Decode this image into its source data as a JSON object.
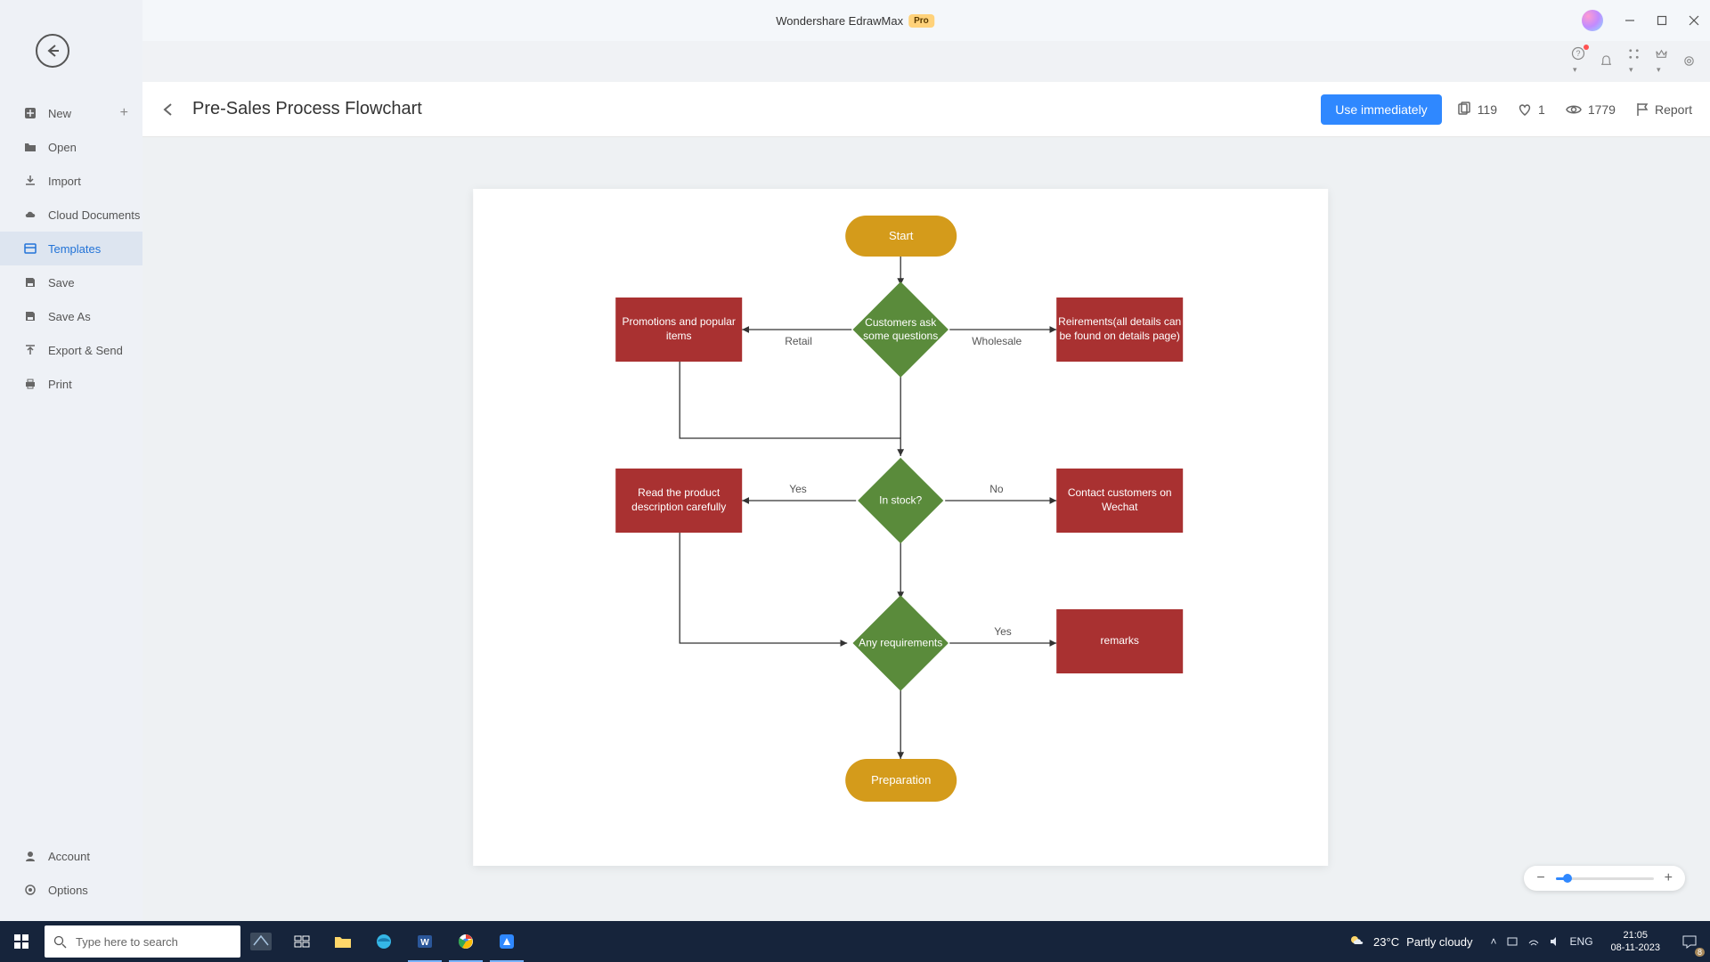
{
  "titlebar": {
    "app": "Wondershare EdrawMax",
    "pro": "Pro"
  },
  "sidebar": {
    "items": [
      {
        "label": "New"
      },
      {
        "label": "Open"
      },
      {
        "label": "Import"
      },
      {
        "label": "Cloud Documents"
      },
      {
        "label": "Templates"
      },
      {
        "label": "Save"
      },
      {
        "label": "Save As"
      },
      {
        "label": "Export & Send"
      },
      {
        "label": "Print"
      }
    ],
    "bottom": [
      {
        "label": "Account"
      },
      {
        "label": "Options"
      }
    ]
  },
  "header": {
    "title": "Pre-Sales Process Flowchart",
    "use_btn": "Use immediately",
    "copies": "119",
    "likes": "1",
    "views": "1779",
    "report": "Report"
  },
  "flowchart": {
    "start": "Start",
    "dec1": "Customers ask some questions",
    "dec2": "In stock?",
    "dec3": "Any requirements",
    "proc_promo": "Promotions and popular items",
    "proc_reqs": "Reirements(all details can be found on details page)",
    "proc_read": "Read the product description carefully",
    "proc_contact": "Contact customers on Wechat",
    "proc_remarks": "remarks",
    "end": "Preparation",
    "lbl_retail": "Retail",
    "lbl_wholesale": "Wholesale",
    "lbl_yes1": "Yes",
    "lbl_no": "No",
    "lbl_yes2": "Yes"
  },
  "search_placeholder": "Type here to search",
  "weather": {
    "temp": "23°C",
    "desc": "Partly cloudy"
  },
  "tray": {
    "lang": "ENG"
  },
  "clock": {
    "time": "21:05",
    "date": "08-11-2023"
  },
  "notif_badge": "8"
}
